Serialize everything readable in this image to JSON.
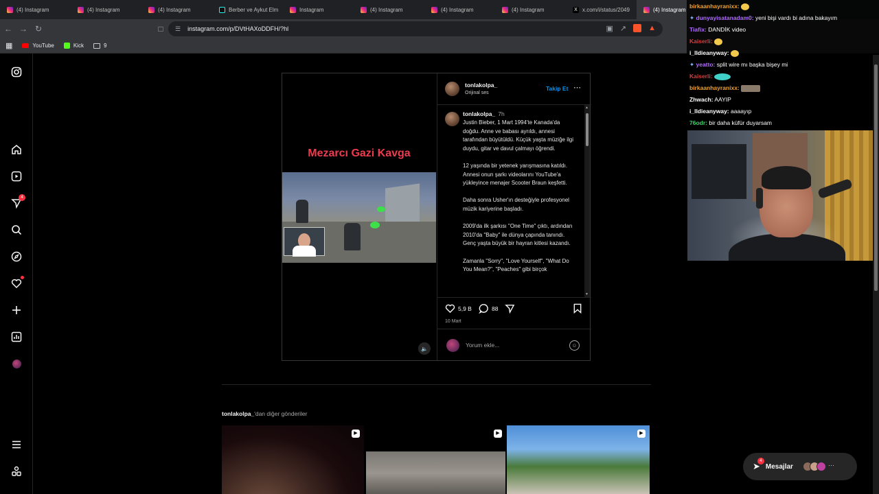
{
  "browser": {
    "tabs": [
      {
        "label": "(4) Instagram",
        "icon": "instagram"
      },
      {
        "label": "(4) Instagram",
        "icon": "instagram"
      },
      {
        "label": "(4) Instagram",
        "icon": "instagram"
      },
      {
        "label": "Berber ve Aykut Elm",
        "icon": "tiktok"
      },
      {
        "label": "Instagram",
        "icon": "instagram"
      },
      {
        "label": "(4) Instagram",
        "icon": "instagram"
      },
      {
        "label": "(4) Instagram",
        "icon": "instagram"
      },
      {
        "label": "(4) Instagram",
        "icon": "instagram"
      },
      {
        "label": "x.com/i/status/2049",
        "icon": "x"
      },
      {
        "label": "(4) Instagram",
        "icon": "instagram"
      }
    ],
    "address": "instagram.com/p/DVtHAXoDDFH/?hl",
    "bookmarks": [
      {
        "label": "YouTube"
      },
      {
        "label": "Kick"
      },
      {
        "label": "9"
      }
    ]
  },
  "sidebar": {
    "notification_count": "4"
  },
  "post": {
    "video_title": "Mezarcı Gazi Kavga",
    "username": "tonlakolpa_",
    "audio": "Orijinal ses",
    "follow_label": "Takip Et",
    "caption_username": "tonlakolpa_",
    "caption_time": "7h",
    "caption_paragraphs": [
      "Justin Bieber, 1 Mart 1994'te Kanada'da doğdu. Anne ve babası ayrıldı, annesi tarafından büyütüldü. Küçük yaşta müziğe ilgi duydu, gitar ve davul çalmayı öğrendi.",
      "12 yaşında bir yetenek yarışmasına katıldı. Annesi onun şarkı videolarını YouTube'a yükleyince menajer Scooter Braun keşfetti.",
      "Daha sonra Usher'ın desteğiyle profesyonel müzik kariyerine başladı.",
      "2009'da ilk şarkısı \"One Time\" çıktı, ardından 2010'da \"Baby\" ile dünya çapında tanındı. Genç yaşta büyük bir hayran kitlesi kazandı.",
      "Zamanla \"Sorry\", \"Love Yourself\", \"What Do You Mean?\", \"Peaches\" gibi birçok"
    ],
    "likes": "5,9 B",
    "comments": "88",
    "date": "10 Mart",
    "comment_placeholder": "Yorum ekle..."
  },
  "more_posts": {
    "username": "tonlakolpa_",
    "suffix": "'dan diğer gönderiler"
  },
  "messages": {
    "label": "Mesajlar",
    "badge": "4"
  },
  "stream_chat": [
    {
      "user": "birkaanhayranixx:",
      "color": "#f0a030",
      "text": ""
    },
    {
      "user": "dunyayisatanadam0:",
      "color": "#b06cff",
      "text": "yeni bişi vardı bi adına bakayım"
    },
    {
      "user": "Tiafix:",
      "color": "#b06cff",
      "text": "DANDİK video"
    },
    {
      "user": "Kaiserli:",
      "color": "#e03a3a",
      "text": ""
    },
    {
      "user": "i_lldieanyway:",
      "color": "#ffffff",
      "text": ""
    },
    {
      "user": "yeatto:",
      "color": "#b06cff",
      "text": "split wire mı başka bişey mi"
    },
    {
      "user": "Kaiserli:",
      "color": "#e03a3a",
      "text": ""
    },
    {
      "user": "birkaanhayranixx:",
      "color": "#f0a030",
      "text": ""
    },
    {
      "user": "Zhwach:",
      "color": "#ffffff",
      "text": "AAYIP"
    },
    {
      "user": "i_lldieanyway:",
      "color": "#ffffff",
      "text": "aaaayıp"
    },
    {
      "user": "76odr:",
      "color": "#3fd06b",
      "text": "bir daha küfür duyarsam"
    }
  ]
}
